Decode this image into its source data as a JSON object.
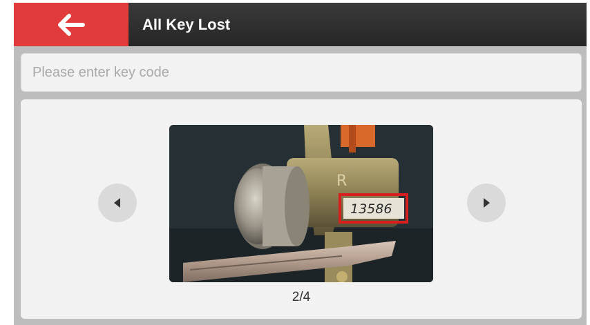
{
  "header": {
    "title": "All Key Lost",
    "back_icon": "arrow-left-icon",
    "accent_color": "#e23b3b"
  },
  "search": {
    "placeholder": "Please enter key code",
    "value": ""
  },
  "gallery": {
    "page_indicator": "2/4",
    "key_code_on_photo": "13586",
    "lock_stamp_text": "R",
    "prev_icon": "caret-left-icon",
    "next_icon": "caret-right-icon",
    "highlight_color": "#d81e1e"
  }
}
